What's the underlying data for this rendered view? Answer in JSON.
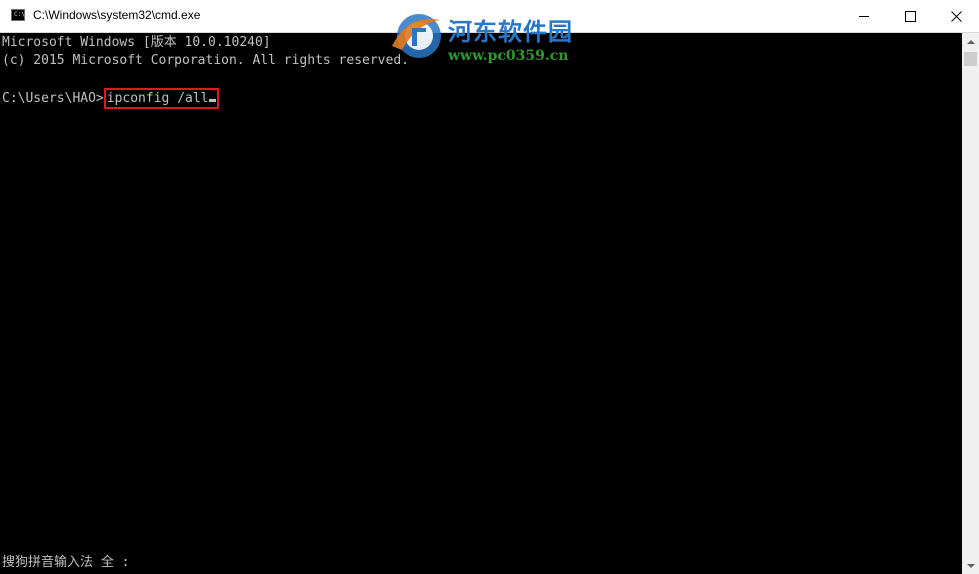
{
  "window": {
    "title": "C:\\Windows\\system32\\cmd.exe",
    "icon": "cmd-icon",
    "icon_text": "C:\\"
  },
  "console": {
    "line1": "Microsoft Windows [版本 10.0.10240]",
    "line2": "(c) 2015 Microsoft Corporation. All rights reserved.",
    "prompt": "C:\\Users\\HAO>",
    "command": "ipconfig /all",
    "ime_status": "搜狗拼音输入法 全 :"
  },
  "watermark": {
    "name": "河东软件园",
    "url": "www.pc0359.cn"
  },
  "colors": {
    "console_bg": "#000000",
    "console_text": "#c0c0c0",
    "highlight": "#e01818",
    "watermark_blue": "#2a76c6",
    "watermark_green": "#2e9a2e"
  }
}
